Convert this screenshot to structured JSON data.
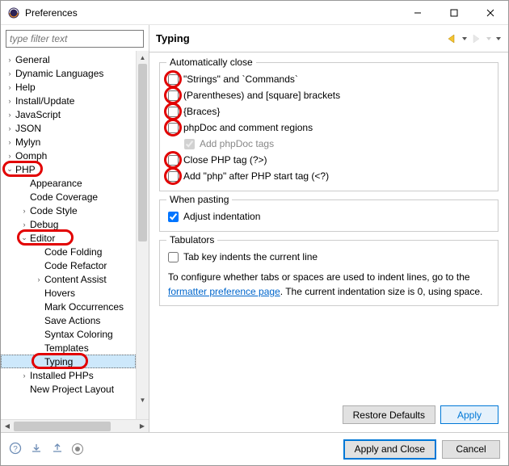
{
  "window": {
    "title": "Preferences"
  },
  "sidebar": {
    "filter_placeholder": "type filter text",
    "items": [
      {
        "label": "General",
        "depth": 1,
        "exp": ">"
      },
      {
        "label": "Dynamic Languages",
        "depth": 1,
        "exp": ">"
      },
      {
        "label": "Help",
        "depth": 1,
        "exp": ">"
      },
      {
        "label": "Install/Update",
        "depth": 1,
        "exp": ">"
      },
      {
        "label": "JavaScript",
        "depth": 1,
        "exp": ">"
      },
      {
        "label": "JSON",
        "depth": 1,
        "exp": ">"
      },
      {
        "label": "Mylyn",
        "depth": 1,
        "exp": ">"
      },
      {
        "label": "Oomph",
        "depth": 1,
        "exp": ">"
      },
      {
        "label": "PHP",
        "depth": 1,
        "exp": "v",
        "ring": true
      },
      {
        "label": "Appearance",
        "depth": 2,
        "exp": ""
      },
      {
        "label": "Code Coverage",
        "depth": 2,
        "exp": ""
      },
      {
        "label": "Code Style",
        "depth": 2,
        "exp": ">"
      },
      {
        "label": "Debug",
        "depth": 2,
        "exp": ">"
      },
      {
        "label": "Editor",
        "depth": 2,
        "exp": "v",
        "ring": true
      },
      {
        "label": "Code Folding",
        "depth": 3,
        "exp": ""
      },
      {
        "label": "Code Refactor",
        "depth": 3,
        "exp": ""
      },
      {
        "label": "Content Assist",
        "depth": 3,
        "exp": ">"
      },
      {
        "label": "Hovers",
        "depth": 3,
        "exp": ""
      },
      {
        "label": "Mark Occurrences",
        "depth": 3,
        "exp": ""
      },
      {
        "label": "Save Actions",
        "depth": 3,
        "exp": ""
      },
      {
        "label": "Syntax Coloring",
        "depth": 3,
        "exp": ""
      },
      {
        "label": "Templates",
        "depth": 3,
        "exp": ""
      },
      {
        "label": "Typing",
        "depth": 3,
        "exp": "",
        "selected": true,
        "ring": true
      },
      {
        "label": "Installed PHPs",
        "depth": 2,
        "exp": ">"
      },
      {
        "label": "New Project Layout",
        "depth": 2,
        "exp": ""
      }
    ]
  },
  "header": {
    "title": "Typing"
  },
  "groups": {
    "auto_close": {
      "legend": "Automatically close",
      "items": [
        {
          "label": "\"Strings\" and `Commands`",
          "checked": false,
          "ring": true
        },
        {
          "label": "(Parentheses) and [square] brackets",
          "checked": false,
          "ring": true
        },
        {
          "label": "{Braces}",
          "checked": false,
          "ring": true
        },
        {
          "label": "phpDoc and comment regions",
          "checked": false,
          "ring": true
        },
        {
          "label": "Add phpDoc tags",
          "checked": true,
          "indent": true,
          "disabled": true
        },
        {
          "label": "Close PHP tag (?>)",
          "checked": false,
          "ring": true
        },
        {
          "label": "Add \"php\" after PHP start tag (<?)",
          "checked": false,
          "ring": true
        }
      ]
    },
    "when_pasting": {
      "legend": "When pasting",
      "items": [
        {
          "label": "Adjust indentation",
          "checked": true
        }
      ]
    },
    "tabulators": {
      "legend": "Tabulators",
      "items": [
        {
          "label": "Tab key indents the current line",
          "checked": false
        }
      ],
      "note_pre": "To configure whether tabs or spaces are used to indent lines, go to the ",
      "note_link": "formatter preference page",
      "note_post": ". The current indentation size is 0, using space."
    }
  },
  "buttons": {
    "restore": "Restore Defaults",
    "apply": "Apply",
    "apply_close": "Apply and Close",
    "cancel": "Cancel"
  }
}
